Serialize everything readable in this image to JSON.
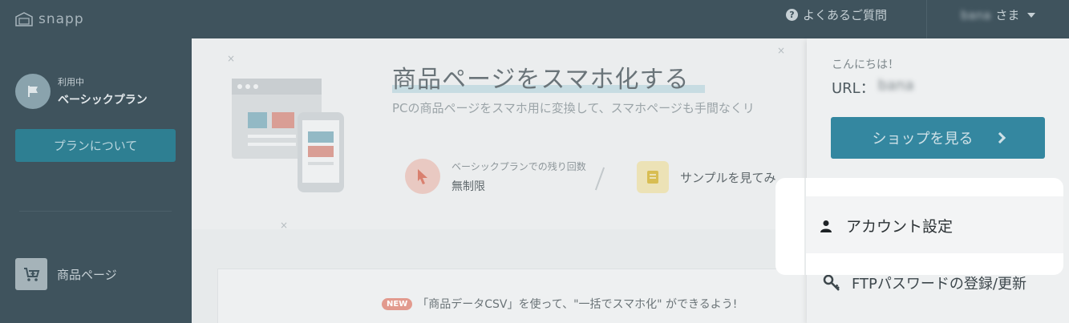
{
  "header": {
    "logo_text": "snapp",
    "faq_label": "よくあるご質問",
    "user_name_blurred": "bana",
    "user_suffix": "さま"
  },
  "sidebar": {
    "plan_status": "利用中",
    "plan_name": "ベーシックプラン",
    "plan_button_label": "プランについて",
    "nav_items": [
      {
        "label": "商品ページ",
        "icon": "cart-plus-icon"
      }
    ]
  },
  "main": {
    "hero_title": "商品ページをスマホ化する",
    "hero_subtitle": "PCの商品ページをスマホ用に変換して、スマホページも手間なくリ",
    "remaining_label": "ベーシックプランでの残り回数",
    "remaining_value": "無制限",
    "sample_label": "サンプルを見てみ",
    "news_badge": "NEW",
    "news_text": "「商品データCSV」を使って、\"一括でスマホ化\" ができるよう!"
  },
  "dropdown": {
    "greeting": "こんにちは！",
    "url_label": "URL：",
    "url_value_blurred": "bana",
    "shop_button_label": "ショップを見る",
    "account_settings_label": "アカウント設定",
    "ftp_label": "FTPパスワードの登録/更新"
  },
  "colors": {
    "topbar": "#3f535d",
    "accent": "#3487a0",
    "badge": "#e29a8e"
  }
}
